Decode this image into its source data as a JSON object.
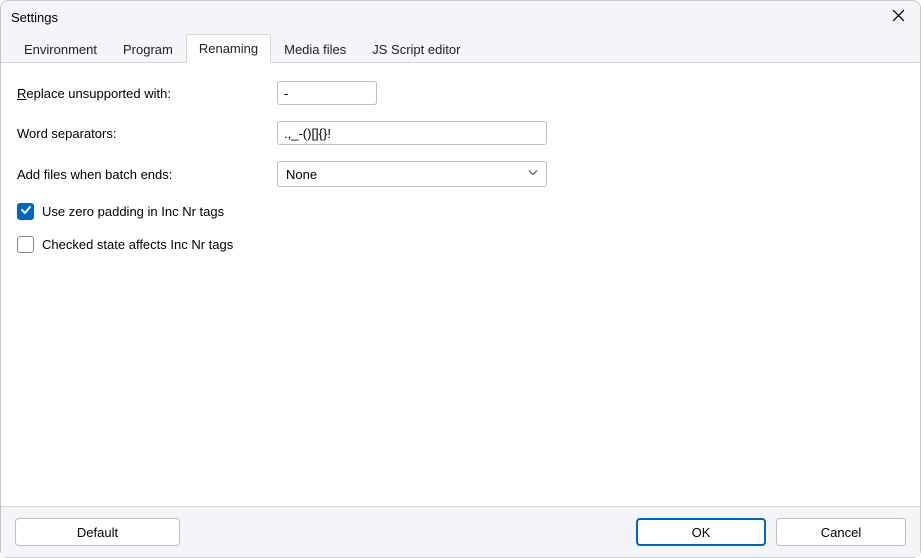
{
  "window": {
    "title": "Settings"
  },
  "tabs": {
    "environment": "Environment",
    "program": "Program",
    "renaming": "Renaming",
    "media_files": "Media files",
    "js_script_editor": "JS Script editor",
    "active": "renaming"
  },
  "form": {
    "replace_unsupported": {
      "label": "Replace unsupported with:",
      "value": "-"
    },
    "word_separators": {
      "label": "Word separators:",
      "value": ".,_-()[]{}!"
    },
    "add_files_batch": {
      "label": "Add files when batch ends:",
      "value": "None"
    },
    "zero_padding": {
      "label": "Use zero padding in Inc Nr tags",
      "checked": true
    },
    "checked_state": {
      "label": "Checked state affects Inc Nr tags",
      "checked": false
    }
  },
  "buttons": {
    "default": "Default",
    "ok": "OK",
    "cancel": "Cancel"
  }
}
